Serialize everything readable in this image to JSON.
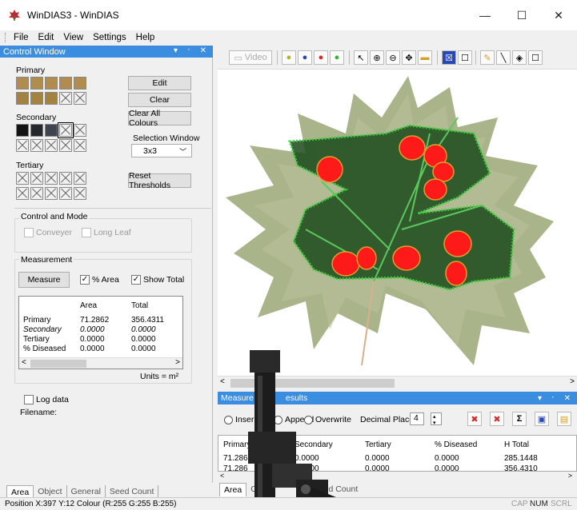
{
  "window": {
    "title": "WinDIAS3 - WinDIAS",
    "minimize": "—",
    "maximize": "☐",
    "close": "✕"
  },
  "menu": [
    "File",
    "Edit",
    "View",
    "Settings",
    "Help"
  ],
  "control_window": {
    "title": "Control Window",
    "header_controls": "▾ ᛫ ✕",
    "primary_label": "Primary",
    "secondary_label": "Secondary",
    "tertiary_label": "Tertiary",
    "colors": {
      "primary_swatch": "#b08d4e",
      "secondary_dark": "#141414",
      "secondary_mid": "#25282d",
      "secondary_slate": "#3f4451"
    },
    "edit_button": "Edit",
    "clear_button": "Clear",
    "clear_all_button": "Clear All Colours",
    "selection_window_label": "Selection Window",
    "selection_window_value": "3x3",
    "reset_thresholds_button": "Reset Thresholds",
    "control_mode": {
      "title": "Control and Mode",
      "conveyer": "Conveyer",
      "long_leaf": "Long Leaf"
    },
    "measurement": {
      "title": "Measurement",
      "measure_button": "Measure",
      "pct_area": "% Area",
      "show_total": "Show Total",
      "checkmark": "✓",
      "col_area": "Area",
      "col_total": "Total",
      "rows": [
        {
          "label": "Primary",
          "area": "71.2862",
          "total": "356.4311"
        },
        {
          "label": "Secondary",
          "area": "0.0000",
          "total": "0.0000"
        },
        {
          "label": "Tertiary",
          "area": "0.0000",
          "total": "0.0000"
        },
        {
          "label": "% Diseased",
          "area": "0.0000",
          "total": "0.0000"
        }
      ],
      "units": "Units = m²"
    },
    "log_data": "Log data",
    "filename_label": "Filename:",
    "tabs": [
      "Area",
      "Object",
      "General",
      "Seed Count"
    ]
  },
  "toolbar": {
    "video_label": "Video"
  },
  "results": {
    "title_left": "Measure",
    "title_right": "esults",
    "header_controls": "▾ ᛫ ✕",
    "insert": "Inser",
    "append": "Append",
    "overwrite": "Overwrite",
    "decimal_label": "Decimal Places",
    "decimal_value": "4",
    "sigma": "Σ",
    "columns": [
      "Primary",
      "Secondary",
      "Tertiary",
      "% Diseased",
      "H Total"
    ],
    "row1": [
      "71.286",
      "0.0000",
      "0.0000",
      "0.0000",
      "285.1448"
    ],
    "row2": [
      "71.286",
      "0.0000",
      "0.0000",
      "0.0000",
      "356.4310"
    ],
    "tabs_left": "Area",
    "tabs_c": "C",
    "tabs_right": "Seed Count"
  },
  "statusbar": {
    "position": "Position X:397 Y:12 Colour (R:255 G:255 B:255)",
    "cap": "CAP",
    "num": "NUM",
    "scrl": "SCRL"
  }
}
